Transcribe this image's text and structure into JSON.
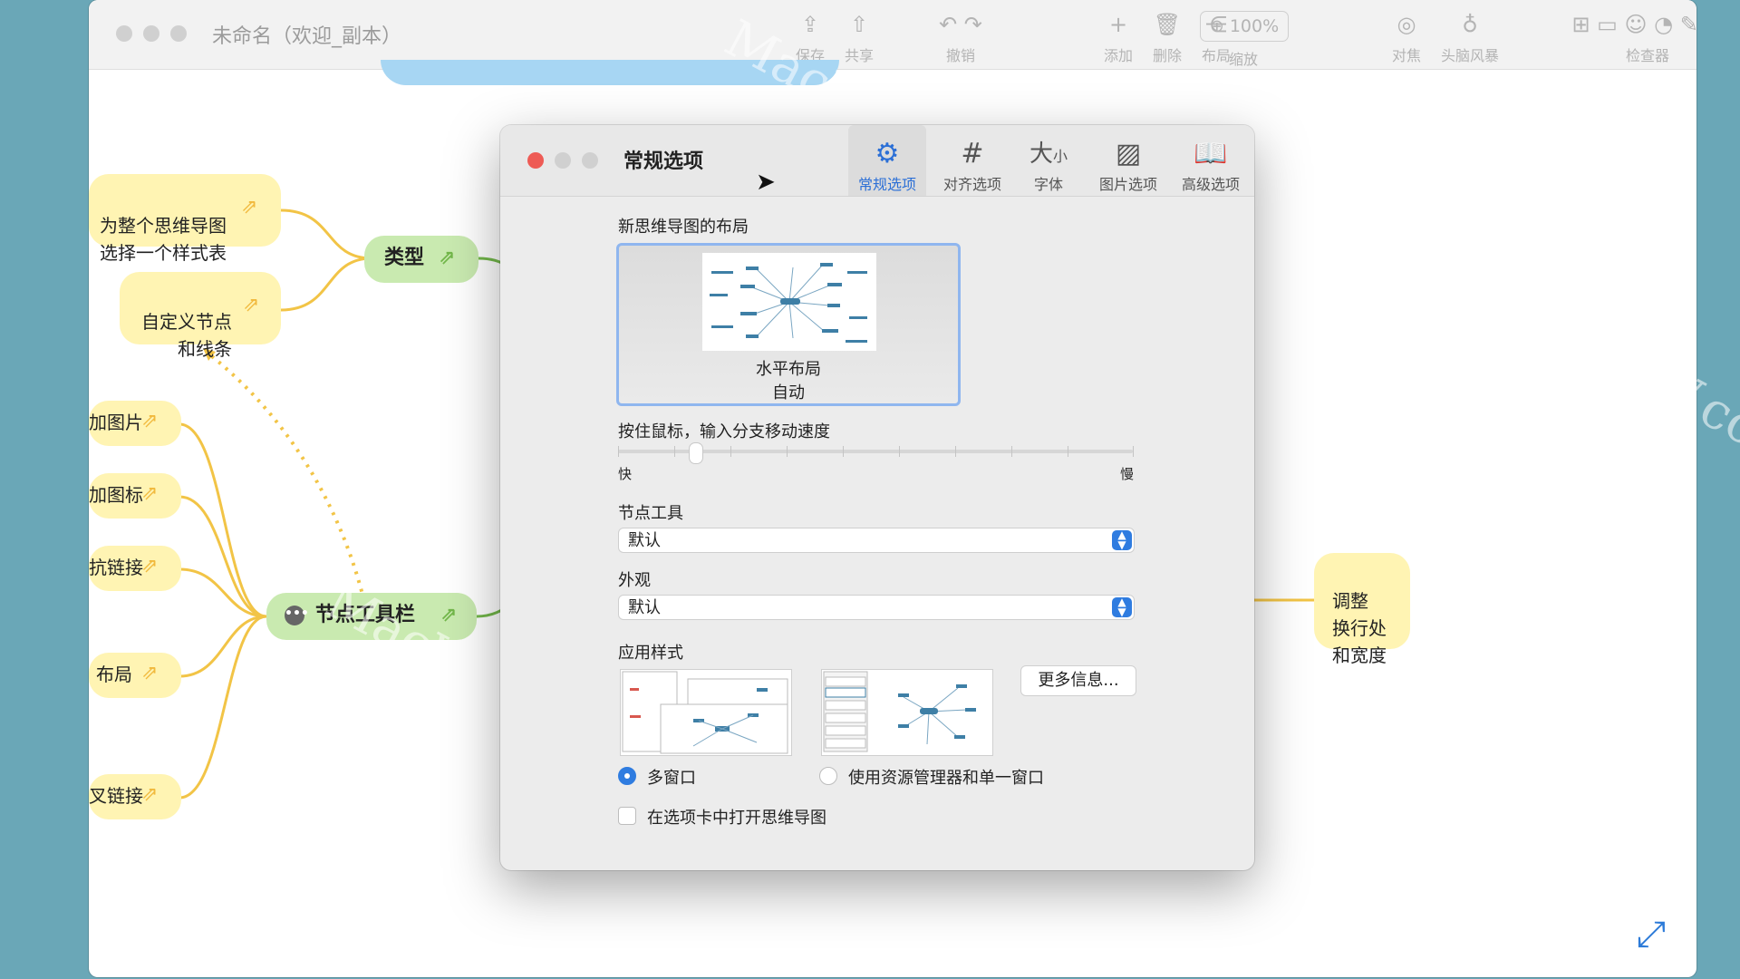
{
  "window": {
    "title": "未命名（欢迎_副本）"
  },
  "toolbar": {
    "items": [
      {
        "label": "保存",
        "icon": "save-icon"
      },
      {
        "label": "共享",
        "icon": "share-icon"
      },
      {
        "label": "撤销",
        "icon": "undo-icon"
      },
      {
        "label": "添加",
        "icon": "plus-icon"
      },
      {
        "label": "删除",
        "icon": "trash-icon"
      },
      {
        "label": "布局",
        "icon": "layout-icon"
      },
      {
        "label": "缩放",
        "icon": "zoom-icon"
      },
      {
        "label": "对焦",
        "icon": "focus-icon"
      },
      {
        "label": "头脑风暴",
        "icon": "bulb-icon"
      },
      {
        "label": "检查器",
        "icon": "inspector-icon"
      }
    ],
    "zoom_value": "100%"
  },
  "mindmap": {
    "nodes": {
      "style": "为整个思维导图\n选择一个样式表",
      "custom": "自定义节点\n和线条",
      "type": "类型",
      "add_image": "加图片",
      "add_icon": "加图标",
      "link": "抗链接",
      "layout": "布局",
      "cross_link": "叉链接",
      "node_toolbar": "节点工具栏",
      "adjust": "调整\n换行处\n和宽度"
    }
  },
  "watermark": "MacW.com",
  "dialog": {
    "title": "常规选项",
    "tabs": [
      {
        "label": "常规选项",
        "icon": "gears-icon",
        "active": true
      },
      {
        "label": "对齐选项",
        "icon": "grid-icon",
        "active": false
      },
      {
        "label": "字体",
        "icon": "font-size-icon",
        "active": false
      },
      {
        "label": "图片选项",
        "icon": "image-icon",
        "active": false
      },
      {
        "label": "高级选项",
        "icon": "book-icon",
        "active": false
      }
    ],
    "layout_section_label": "新思维导图的布局",
    "layout_name": "水平布局",
    "layout_mode": "自动",
    "speed_label": "按住鼠标，输入分支移动速度",
    "speed_fast": "快",
    "speed_slow": "慢",
    "speed_value": 0.15,
    "node_tool_label": "节点工具",
    "node_tool_value": "默认",
    "appearance_label": "外观",
    "appearance_value": "默认",
    "app_style_label": "应用样式",
    "more_info_button": "更多信息...",
    "option_multi_window": "多窗口",
    "option_single_window": "使用资源管理器和单一窗口",
    "open_in_tabs": "在选项卡中打开思维导图"
  },
  "colors": {
    "accent": "#2f7ce0",
    "node_yellow": "#fff4b3",
    "node_green": "#c9eab0",
    "branch_line": "#f2c446"
  }
}
